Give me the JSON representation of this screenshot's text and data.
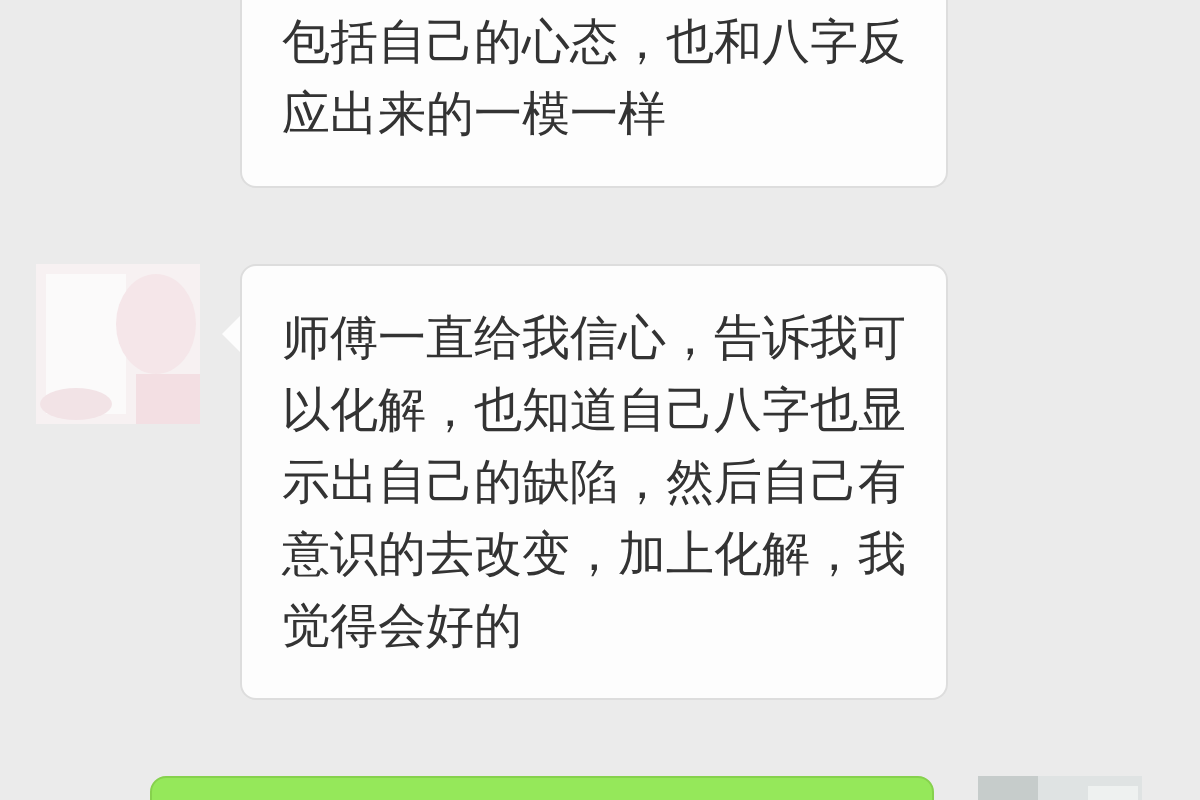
{
  "messages": [
    {
      "kind": "received",
      "avatar": false,
      "text": "包括自己的心态，也和八字反应出来的一模一样"
    },
    {
      "kind": "received",
      "avatar": true,
      "text": "师傅一直给我信心，告诉我可以化解，也知道自己八字也显示出自己的缺陷，然后自己有意识的去改变，加上化解，我觉得会好的"
    },
    {
      "kind": "sent",
      "avatar": true
    }
  ]
}
